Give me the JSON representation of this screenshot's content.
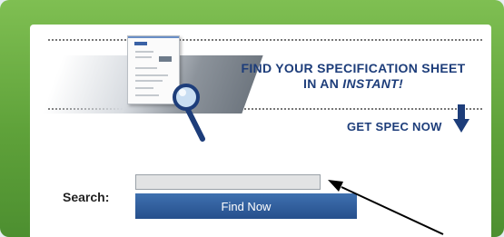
{
  "banner": {
    "headline_line1": "FIND YOUR SPECIFICATION SHEET",
    "headline_line2_prefix": "IN AN ",
    "headline_line2_emphasis": "INSTANT!",
    "cta": "GET SPEC NOW"
  },
  "search": {
    "label": "Search:",
    "value": "",
    "button_label": "Find Now"
  },
  "colors": {
    "frame_green": "#5fa23a",
    "brand_blue": "#1d3d7a",
    "button_blue": "#2f5d9b"
  },
  "icons": [
    "spec-sheet-icon",
    "magnifying-glass-icon",
    "down-arrow-icon",
    "pointer-arrow-icon"
  ]
}
